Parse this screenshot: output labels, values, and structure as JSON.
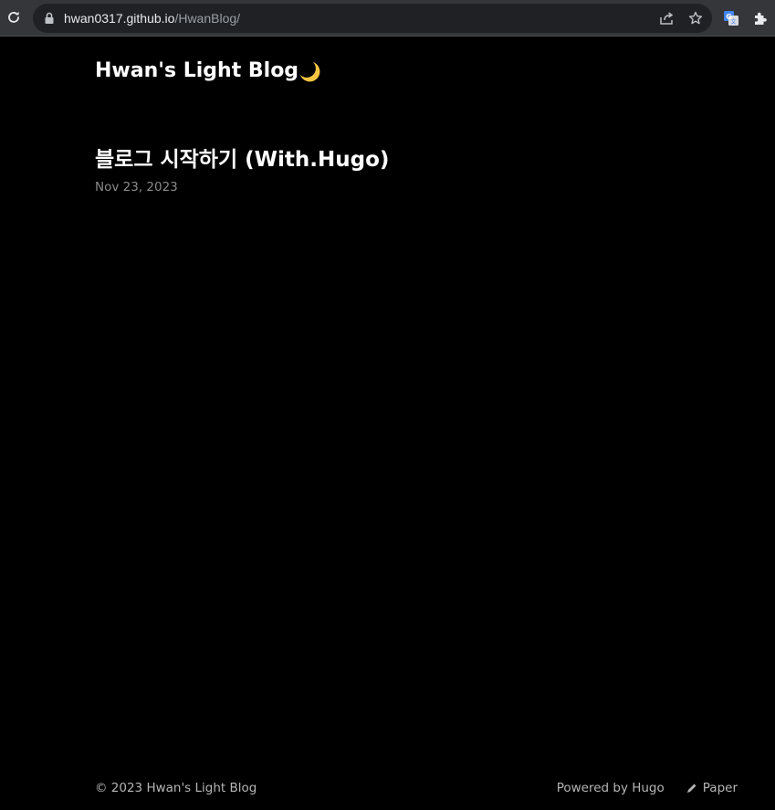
{
  "browser": {
    "url_host": "hwan0317.github.io",
    "url_path": "/HwanBlog/"
  },
  "site": {
    "title": "Hwan's Light Blog",
    "theme_toggle_icon": "moon-icon"
  },
  "posts": [
    {
      "title": "블로그 시작하기 (With.Hugo)",
      "date": "Nov 23, 2023"
    }
  ],
  "footer": {
    "copyright": "© 2023 Hwan's Light Blog",
    "powered_by": "Powered by Hugo",
    "theme_link": "Paper"
  },
  "colors": {
    "background": "#000000",
    "toolbar": "#35363a",
    "omnibox": "#202124",
    "moon": "#f5c542"
  }
}
